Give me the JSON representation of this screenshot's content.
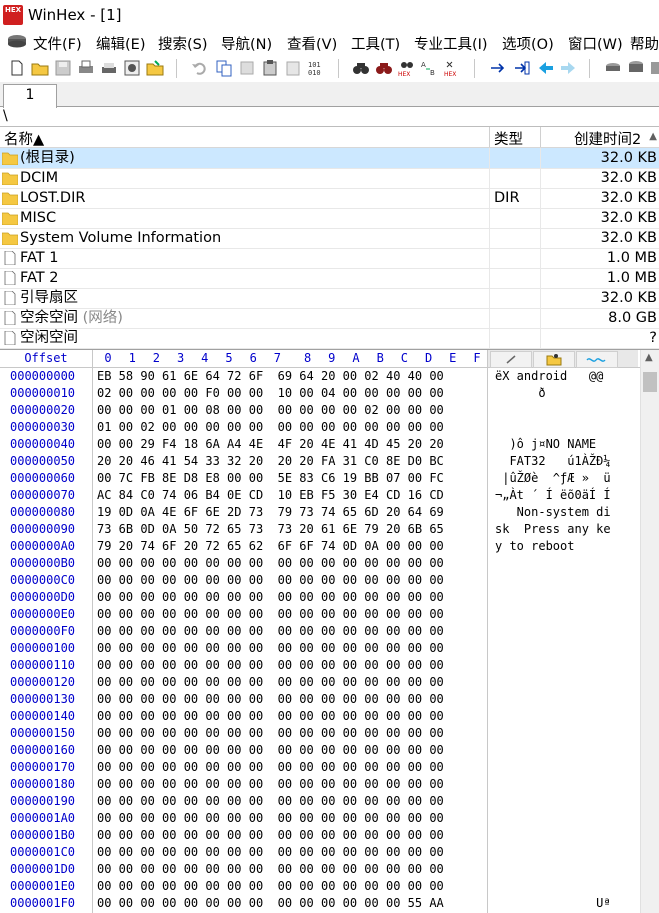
{
  "window": {
    "title": "WinHex - [1]",
    "logo_text": "HEX"
  },
  "menu": {
    "items": [
      "文件(F)",
      "编辑(E)",
      "搜索(S)",
      "导航(N)",
      "查看(V)",
      "工具(T)",
      "专业工具(I)",
      "选项(O)",
      "窗口(W)",
      "帮助"
    ]
  },
  "toolbar": {
    "icons": [
      "new-file-icon",
      "open-folder-icon",
      "save-icon",
      "print-icon",
      "printer-alt-icon",
      "properties-icon",
      "open-folder-alt-icon",
      "undo-icon",
      "copy-icon",
      "cut-icon",
      "paste-icon",
      "paste-alt-icon",
      "binary-icon",
      "find-icon",
      "find-next-icon",
      "find-hex-icon",
      "replace-icon",
      "replace-hex-icon",
      "goto-offset-icon",
      "goto-icon",
      "back-arrow-icon",
      "forward-arrow-icon",
      "disk-icon",
      "disk-stack-icon",
      "disk-image-icon"
    ]
  },
  "tabs": [
    {
      "label": "1"
    }
  ],
  "path": "\\",
  "dir_list": {
    "columns": {
      "name": "名称▲",
      "type": "类型",
      "created": "创建时间2"
    },
    "rows": [
      {
        "name": "(根目录)",
        "muted": "",
        "type": "",
        "size": "32.0 KB",
        "icon": "folder-icon",
        "selected": true
      },
      {
        "name": "DCIM",
        "muted": "",
        "type": "",
        "size": "32.0 KB",
        "icon": "folder-icon",
        "selected": false
      },
      {
        "name": "LOST.DIR",
        "muted": "",
        "type": "DIR",
        "size": "32.0 KB",
        "icon": "folder-icon",
        "selected": false
      },
      {
        "name": "MISC",
        "muted": "",
        "type": "",
        "size": "32.0 KB",
        "icon": "folder-icon",
        "selected": false
      },
      {
        "name": "System Volume Information",
        "muted": "",
        "type": "",
        "size": "32.0 KB",
        "icon": "folder-icon",
        "selected": false
      },
      {
        "name": "FAT 1",
        "muted": "",
        "type": "",
        "size": "1.0 MB",
        "icon": "file-icon",
        "selected": false
      },
      {
        "name": "FAT 2",
        "muted": "",
        "type": "",
        "size": "1.0 MB",
        "icon": "file-icon",
        "selected": false
      },
      {
        "name": "引导扇区",
        "muted": "",
        "type": "",
        "size": "32.0 KB",
        "icon": "file-icon",
        "selected": false
      },
      {
        "name": "空余空间 ",
        "muted": "(网络)",
        "type": "",
        "size": "8.0 GB",
        "icon": "file-icon",
        "selected": false
      },
      {
        "name": "空闲空间",
        "muted": "",
        "type": "",
        "size": "?",
        "icon": "file-icon",
        "selected": false
      }
    ]
  },
  "hex": {
    "offset_label": "Offset",
    "col_labels": [
      "0",
      "1",
      "2",
      "3",
      "4",
      "5",
      "6",
      "7",
      "8",
      "9",
      "A",
      "B",
      "C",
      "D",
      "E",
      "F"
    ],
    "rows": [
      {
        "offset": "000000000",
        "bytes": "EB 58 90 61 6E 64 72 6F  69 64 20 00 02 40 40 00",
        "ascii": "ëX android   @@"
      },
      {
        "offset": "000000010",
        "bytes": "02 00 00 00 00 F0 00 00  10 00 04 00 00 00 00 00",
        "ascii": "      ð"
      },
      {
        "offset": "000000020",
        "bytes": "00 00 00 01 00 08 00 00  00 00 00 00 02 00 00 00",
        "ascii": ""
      },
      {
        "offset": "000000030",
        "bytes": "01 00 02 00 00 00 00 00  00 00 00 00 00 00 00 00",
        "ascii": ""
      },
      {
        "offset": "000000040",
        "bytes": "00 00 29 F4 18 6A A4 4E  4F 20 4E 41 4D 45 20 20",
        "ascii": "  )ô j¤NO NAME"
      },
      {
        "offset": "000000050",
        "bytes": "20 20 46 41 54 33 32 20  20 20 FA 31 C0 8E D0 BC",
        "ascii": "  FAT32   ú1ÀŽÐ¼"
      },
      {
        "offset": "000000060",
        "bytes": "00 7C FB 8E D8 E8 00 00  5E 83 C6 19 BB 07 00 FC",
        "ascii": " |ûŽØè  ^ƒÆ »  ü"
      },
      {
        "offset": "000000070",
        "bytes": "AC 84 C0 74 06 B4 0E CD  10 EB F5 30 E4 CD 16 CD",
        "ascii": "¬„Àt ´ Í ëõ0äÍ Í"
      },
      {
        "offset": "000000080",
        "bytes": "19 0D 0A 4E 6F 6E 2D 73  79 73 74 65 6D 20 64 69",
        "ascii": "   Non-system di"
      },
      {
        "offset": "000000090",
        "bytes": "73 6B 0D 0A 50 72 65 73  73 20 61 6E 79 20 6B 65",
        "ascii": "sk  Press any ke"
      },
      {
        "offset": "0000000A0",
        "bytes": "79 20 74 6F 20 72 65 62  6F 6F 74 0D 0A 00 00 00",
        "ascii": "y to reboot"
      },
      {
        "offset": "0000000B0",
        "bytes": "00 00 00 00 00 00 00 00  00 00 00 00 00 00 00 00",
        "ascii": ""
      },
      {
        "offset": "0000000C0",
        "bytes": "00 00 00 00 00 00 00 00  00 00 00 00 00 00 00 00",
        "ascii": ""
      },
      {
        "offset": "0000000D0",
        "bytes": "00 00 00 00 00 00 00 00  00 00 00 00 00 00 00 00",
        "ascii": ""
      },
      {
        "offset": "0000000E0",
        "bytes": "00 00 00 00 00 00 00 00  00 00 00 00 00 00 00 00",
        "ascii": ""
      },
      {
        "offset": "0000000F0",
        "bytes": "00 00 00 00 00 00 00 00  00 00 00 00 00 00 00 00",
        "ascii": ""
      },
      {
        "offset": "000000100",
        "bytes": "00 00 00 00 00 00 00 00  00 00 00 00 00 00 00 00",
        "ascii": ""
      },
      {
        "offset": "000000110",
        "bytes": "00 00 00 00 00 00 00 00  00 00 00 00 00 00 00 00",
        "ascii": ""
      },
      {
        "offset": "000000120",
        "bytes": "00 00 00 00 00 00 00 00  00 00 00 00 00 00 00 00",
        "ascii": ""
      },
      {
        "offset": "000000130",
        "bytes": "00 00 00 00 00 00 00 00  00 00 00 00 00 00 00 00",
        "ascii": ""
      },
      {
        "offset": "000000140",
        "bytes": "00 00 00 00 00 00 00 00  00 00 00 00 00 00 00 00",
        "ascii": ""
      },
      {
        "offset": "000000150",
        "bytes": "00 00 00 00 00 00 00 00  00 00 00 00 00 00 00 00",
        "ascii": ""
      },
      {
        "offset": "000000160",
        "bytes": "00 00 00 00 00 00 00 00  00 00 00 00 00 00 00 00",
        "ascii": ""
      },
      {
        "offset": "000000170",
        "bytes": "00 00 00 00 00 00 00 00  00 00 00 00 00 00 00 00",
        "ascii": ""
      },
      {
        "offset": "000000180",
        "bytes": "00 00 00 00 00 00 00 00  00 00 00 00 00 00 00 00",
        "ascii": ""
      },
      {
        "offset": "000000190",
        "bytes": "00 00 00 00 00 00 00 00  00 00 00 00 00 00 00 00",
        "ascii": ""
      },
      {
        "offset": "0000001A0",
        "bytes": "00 00 00 00 00 00 00 00  00 00 00 00 00 00 00 00",
        "ascii": ""
      },
      {
        "offset": "0000001B0",
        "bytes": "00 00 00 00 00 00 00 00  00 00 00 00 00 00 00 00",
        "ascii": ""
      },
      {
        "offset": "0000001C0",
        "bytes": "00 00 00 00 00 00 00 00  00 00 00 00 00 00 00 00",
        "ascii": ""
      },
      {
        "offset": "0000001D0",
        "bytes": "00 00 00 00 00 00 00 00  00 00 00 00 00 00 00 00",
        "ascii": ""
      },
      {
        "offset": "0000001E0",
        "bytes": "00 00 00 00 00 00 00 00  00 00 00 00 00 00 00 00",
        "ascii": ""
      },
      {
        "offset": "0000001F0",
        "bytes": "00 00 00 00 00 00 00 00  00 00 00 00 00 00 55 AA",
        "ascii": "              Uª"
      }
    ]
  },
  "colors": {
    "offset_blue": "#0000cc",
    "selection": "#cce8ff",
    "logo_red": "#d02020"
  }
}
